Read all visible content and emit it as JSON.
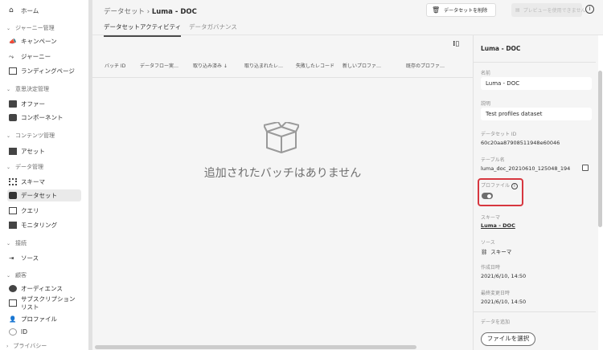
{
  "sidebar": {
    "home": "ホーム",
    "sections": [
      {
        "label": "ジャーニー管理",
        "items": [
          "キャンペーン",
          "ジャーニー",
          "ランディングページ"
        ]
      },
      {
        "label": "意思決定管理",
        "items": [
          "オファー",
          "コンポーネント"
        ]
      },
      {
        "label": "コンテンツ管理",
        "items": [
          "アセット"
        ]
      },
      {
        "label": "データ管理",
        "items": [
          "スキーマ",
          "データセット",
          "クエリ",
          "モニタリング"
        ]
      },
      {
        "label": "接続",
        "items": [
          "ソース"
        ]
      },
      {
        "label": "顧客",
        "items": [
          "オーディエンス",
          "サブスクリプションリスト",
          "プロファイル",
          "ID"
        ]
      },
      {
        "label": "プライバシー",
        "items": []
      }
    ],
    "active": "データセット"
  },
  "header": {
    "breadcrumb_parent": "データセット",
    "breadcrumb_sep": "›",
    "title": "Luma - DOC",
    "delete_button": "データセットを削除",
    "preview_button": "プレビューを使用できません",
    "info": "i"
  },
  "tabs": [
    "データセットアクティビティ",
    "データガバナンス"
  ],
  "table": {
    "columns": [
      "バッチ ID",
      "データフロー実…",
      "取り込み済み ↓",
      "取り込まれたレ…",
      "失敗したレコード",
      "新しいプロファ…",
      "既存のプロファ…"
    ],
    "empty_message": "追加されたバッチはありません"
  },
  "panel": {
    "title": "Luma - DOC",
    "name_label": "名前",
    "name_value": "Luma - DOC",
    "desc_label": "説明",
    "desc_value": "Test profiles dataset",
    "id_label": "データセット ID",
    "id_value": "60c20aa879085119​48e60046",
    "table_label": "テーブル名",
    "table_value": "luma_doc_20210610_125048_194",
    "profile_label": "プロファイル",
    "profile_enabled": false,
    "schema_label": "スキーマ",
    "schema_value": "Luma - DOC",
    "source_label": "ソース",
    "source_value": "スキーマ",
    "created_label": "作成日時",
    "created_value": "2021/6/10, 14:50",
    "modified_label": "最終変更日時",
    "modified_value": "2021/6/10, 14:50",
    "add_data_label": "データを追加",
    "file_button": "ファイルを選択"
  }
}
